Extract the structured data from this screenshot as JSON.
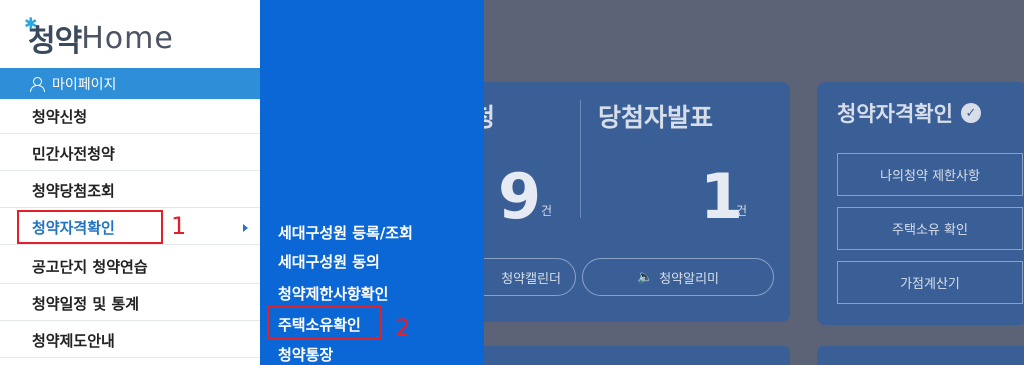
{
  "logo": {
    "text_korean": "청약",
    "text_home": "Home"
  },
  "left_menu": {
    "mypage_label": "마이페이지",
    "items": [
      {
        "label": "청약신청"
      },
      {
        "label": "민간사전청약"
      },
      {
        "label": "청약당첨조회"
      },
      {
        "label": "청약자격확인"
      },
      {
        "label": "공고단지 청약연습"
      },
      {
        "label": "청약일정 및 통계"
      },
      {
        "label": "청약제도안내"
      }
    ]
  },
  "submenu": {
    "items": [
      {
        "label": "세대구성원 등록/조회"
      },
      {
        "label": "세대구성원 동의"
      },
      {
        "label": "청약제한사항확인"
      },
      {
        "label": "주택소유확인"
      },
      {
        "label": "청약통장"
      }
    ]
  },
  "annotations": {
    "mark1": "1",
    "mark2": "2"
  },
  "dashboard": {
    "col1_title_fragment": "청",
    "col1_count": "9",
    "col1_unit": "건",
    "col2_title": "당첨자발표",
    "col2_count": "1",
    "col2_unit": "건",
    "calendar_label": "청약캘린더",
    "alarm_label": "청약알리미",
    "side_title": "청약자격확인",
    "side_buttons": [
      {
        "label": "나의청약 제한사항"
      },
      {
        "label": "주택소유 확인"
      },
      {
        "label": "가점계산기"
      }
    ]
  },
  "colors": {
    "primary_blue": "#2e8fd8",
    "submenu_blue": "#0c67d6",
    "highlight_red": "#e2202a",
    "active_text": "#2272c3"
  }
}
